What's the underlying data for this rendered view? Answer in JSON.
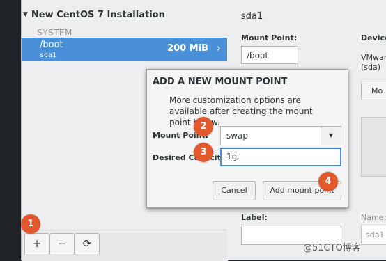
{
  "left": {
    "header": "New CentOS 7 Installation",
    "system_label": "SYSTEM",
    "selected_mount": {
      "name": "/boot",
      "device": "sda1",
      "size": "200 MiB"
    },
    "toolbar": {
      "add_label": "+",
      "remove_label": "−",
      "refresh_label": "⟳"
    }
  },
  "right": {
    "title": "sda1",
    "mount_point_label": "Mount Point:",
    "mount_point_value": "/boot",
    "device_label": "Device",
    "device_value_line1": "VMwar",
    "device_value_line2": "(sda)",
    "modify_button": "Mo",
    "label_label": "Label:",
    "name_label": "Name:",
    "name_value": "sda1"
  },
  "dialog": {
    "title": "ADD A NEW MOUNT POINT",
    "description": "More customization options are available after creating the mount point below.",
    "mount_point_label": "Mount Point:",
    "mount_point_value": "swap",
    "capacity_label": "Desired Capacity:",
    "capacity_value": "1g",
    "cancel_button": "Cancel",
    "add_button": "Add mount point"
  },
  "badges": [
    "1",
    "2",
    "3",
    "4"
  ],
  "watermark": "@51CTO博客"
}
